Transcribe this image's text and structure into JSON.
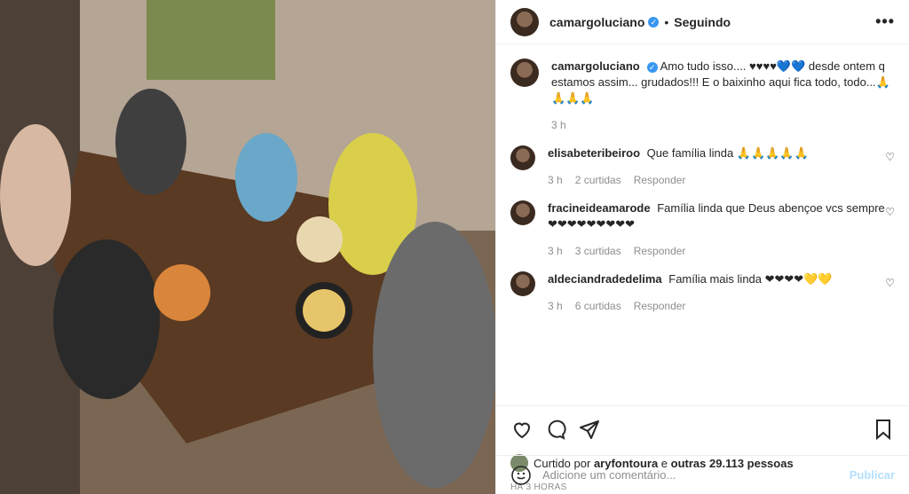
{
  "post": {
    "image_alt": "Family at restaurant table"
  },
  "header": {
    "username": "camargoluciano",
    "follow_state": "Seguindo",
    "more": "•••"
  },
  "caption": {
    "username": "camargoluciano",
    "text": "Amo tudo isso.... ♥♥♥♥💙💙 desde ontem q estamos assim... grudados!!! E o baixinho aqui fica todo, todo...🙏🙏🙏🙏",
    "time": "3 h"
  },
  "comments": [
    {
      "username": "elisabeteribeiroo",
      "text": "Que família linda 🙏🙏🙏🙏🙏",
      "time": "3 h",
      "likes": "2 curtidas",
      "reply": "Responder"
    },
    {
      "username": "fracineideamarode",
      "text": "Família linda que Deus abençoe vcs sempre ❤❤❤❤❤❤❤❤❤",
      "time": "3 h",
      "likes": "3 curtidas",
      "reply": "Responder"
    },
    {
      "username": "aldeciandradedelima",
      "text": "Família mais linda ❤❤❤❤💛💛",
      "time": "3 h",
      "likes": "6 curtidas",
      "reply": "Responder"
    }
  ],
  "likes": {
    "prefix": "Curtido por",
    "user": "aryfontoura",
    "mid": "e",
    "others": "outras 29.113 pessoas"
  },
  "timestamp": "HÁ 3 HORAS",
  "add_comment": {
    "placeholder": "Adicione um comentário...",
    "publish": "Publicar"
  },
  "icons": [
    "heart-icon",
    "comment-icon",
    "share-icon",
    "bookmark-icon",
    "emoji-icon",
    "verified-icon"
  ]
}
